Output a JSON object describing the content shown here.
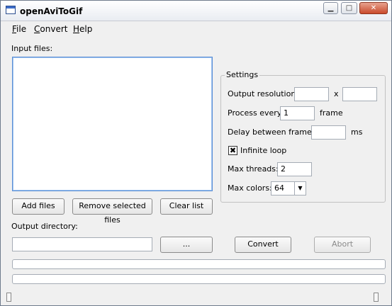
{
  "window": {
    "title": "openAviToGif",
    "controls": {
      "minimize": "▁",
      "maximize": "□",
      "close": "✕"
    }
  },
  "menu": {
    "file": {
      "mnemonic": "F",
      "rest": "ile"
    },
    "convert": {
      "mnemonic": "C",
      "rest": "onvert"
    },
    "help": {
      "mnemonic": "H",
      "rest": "elp"
    }
  },
  "input": {
    "label": "Input files:",
    "files": []
  },
  "buttons": {
    "add_files": "Add files",
    "remove_selected": "Remove selected files",
    "clear_list": "Clear list",
    "browse": "...",
    "convert": "Convert",
    "abort": "Abort"
  },
  "settings": {
    "title": "Settings",
    "output_resolution_label": "Output resolution:",
    "resolution_width": "",
    "resolution_separator": "x",
    "resolution_height": "",
    "process_every_label": "Process every",
    "process_every_value": "1",
    "process_every_unit": "frame",
    "delay_label": "Delay between frames:",
    "delay_value": "",
    "delay_unit": "ms",
    "infinite_loop_label": "Infinite loop",
    "infinite_loop_checked": true,
    "checkbox_glyph": "✖",
    "max_threads_label": "Max threads:",
    "max_threads_value": "2",
    "max_colors_label": "Max colors:",
    "max_colors_value": "64",
    "combo_arrow": "▼"
  },
  "output": {
    "label": "Output directory:",
    "directory": ""
  },
  "progress": [
    {
      "value": 0
    },
    {
      "value": 0
    }
  ]
}
